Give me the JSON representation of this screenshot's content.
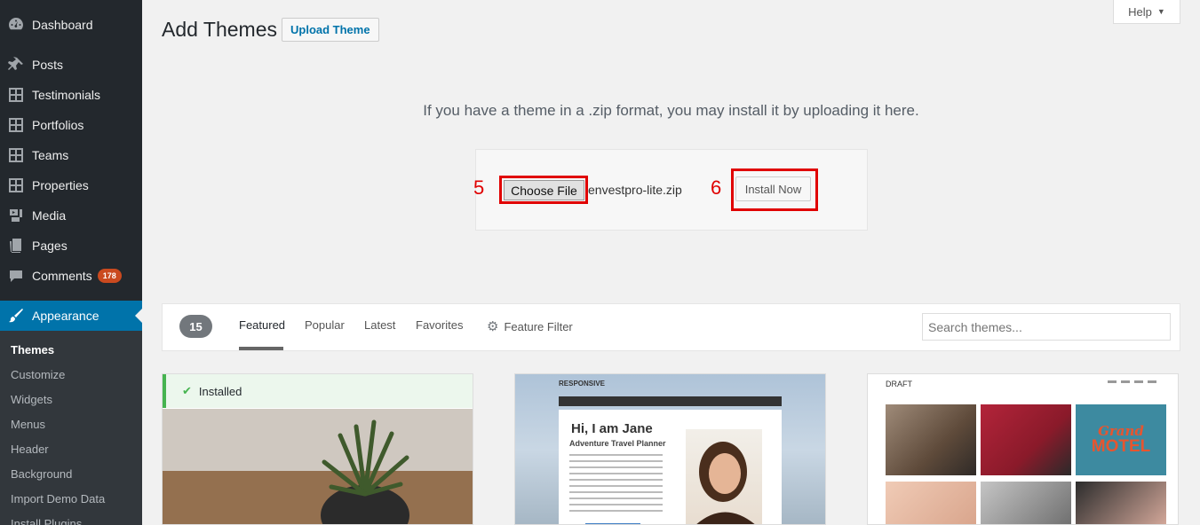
{
  "sidebar": {
    "items": [
      {
        "label": "Dashboard",
        "icon": "dashboard-icon"
      },
      {
        "label": "Posts",
        "icon": "pin-icon"
      },
      {
        "label": "Testimonials",
        "icon": "grid-icon"
      },
      {
        "label": "Portfolios",
        "icon": "grid-icon"
      },
      {
        "label": "Teams",
        "icon": "grid-icon"
      },
      {
        "label": "Properties",
        "icon": "grid-icon"
      },
      {
        "label": "Media",
        "icon": "media-icon"
      },
      {
        "label": "Pages",
        "icon": "pages-icon"
      },
      {
        "label": "Comments",
        "icon": "comments-icon",
        "badge": "178"
      },
      {
        "label": "Appearance",
        "icon": "paintbrush-icon"
      }
    ],
    "submenu": [
      "Themes",
      "Customize",
      "Widgets",
      "Menus",
      "Header",
      "Background",
      "Import Demo Data",
      "Install Plugins"
    ]
  },
  "header": {
    "title": "Add Themes",
    "upload_button": "Upload Theme",
    "help": "Help"
  },
  "upload": {
    "instructions": "If you have a theme in a .zip format, you may install it by uploading it here.",
    "choose_file": "Choose File",
    "file_name": "envestpro-lite.zip",
    "install_now": "Install Now",
    "step_5": "5",
    "step_6": "6"
  },
  "filter": {
    "count": "15",
    "tabs": [
      "Featured",
      "Popular",
      "Latest",
      "Favorites"
    ],
    "feature_filter": "Feature Filter",
    "search_placeholder": "Search themes..."
  },
  "themes": {
    "installed_label": "Installed",
    "responsive": {
      "brand": "RESPONSIVE",
      "heading": "Hi, I am Jane",
      "subheading": "Adventure Travel Planner"
    },
    "draft": {
      "brand": "DRAFT",
      "sign_top": "Grand",
      "sign_bottom": "MOTEL"
    }
  },
  "colors": {
    "sidebar_bg": "#23282d",
    "active_blue": "#0073aa",
    "annotation_red": "#e00000",
    "badge_orange": "#ca4a1f",
    "installed_green": "#46b450"
  }
}
